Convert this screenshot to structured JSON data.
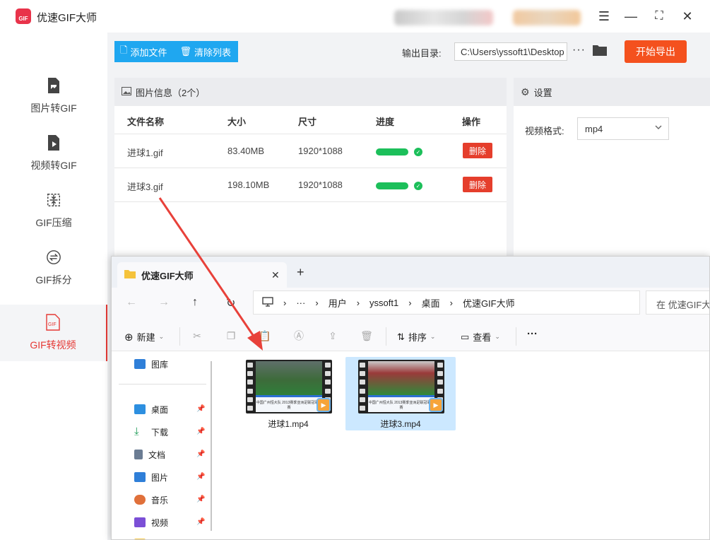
{
  "app": {
    "title": "优速GIF大师",
    "logo_text": "GIF"
  },
  "window_controls": {
    "menu": "☰",
    "minimize": "—",
    "maximize": "⛶",
    "close": "✕"
  },
  "sidebar": {
    "items": [
      {
        "label": "图片转GIF",
        "icon": "image-file-icon"
      },
      {
        "label": "视频转GIF",
        "icon": "video-file-icon"
      },
      {
        "label": "GIF压缩",
        "icon": "compress-icon"
      },
      {
        "label": "GIF拆分",
        "icon": "split-icon"
      },
      {
        "label": "GIF转视频",
        "icon": "gif-file-icon",
        "active": true
      }
    ]
  },
  "toolbar": {
    "add_file": "添加文件",
    "clear_list": "清除列表",
    "output_label": "输出目录:",
    "output_path": "C:\\Users\\yssoft1\\Desktop",
    "more": "···",
    "export": "开始导出"
  },
  "file_panel": {
    "title": "图片信息（2个）",
    "columns": [
      "文件名称",
      "大小",
      "尺寸",
      "进度",
      "操作"
    ],
    "rows": [
      {
        "name": "进球1.gif",
        "size": "83.40MB",
        "dims": "1920*1088",
        "progress": 1.0,
        "action": "删除"
      },
      {
        "name": "进球3.gif",
        "size": "198.10MB",
        "dims": "1920*1088",
        "progress": 1.0,
        "action": "删除"
      }
    ]
  },
  "settings": {
    "title": "设置",
    "format_label": "视频格式:",
    "format_value": "mp4"
  },
  "explorer": {
    "tab_title": "优速GIF大师",
    "new_tab": "+",
    "breadcrumb": [
      "用户",
      "yssoft1",
      "桌面",
      "优速GIF大师"
    ],
    "ellipsis": "···",
    "search_placeholder": "在 优速GIF大师",
    "commands": {
      "new": "新建",
      "sort": "排序",
      "view": "查看",
      "more": "···"
    },
    "sidebar": {
      "gallery": "图库",
      "items": [
        {
          "label": "桌面",
          "color": "#2d8fe0"
        },
        {
          "label": "下载",
          "color": "#1a9a55"
        },
        {
          "label": "文档",
          "color": "#6b7c93"
        },
        {
          "label": "图片",
          "color": "#2f7fd8"
        },
        {
          "label": "音乐",
          "color": "#e0703a"
        },
        {
          "label": "视频",
          "color": "#7b4fd6"
        }
      ]
    },
    "files": [
      {
        "name": "进球1.mp4",
        "selected": false,
        "banner": "中国广州恒大队 2013赛季亚洲足联冠军联赛"
      },
      {
        "name": "进球3.mp4",
        "selected": true,
        "banner": "中国广州恒大队 2013赛季亚洲足联冠军联赛"
      }
    ]
  },
  "colors": {
    "accent_blue": "#1fa7f0",
    "export_orange": "#f4511e",
    "active_red": "#e53935",
    "progress_green": "#1cbf5a",
    "arrow_red": "#e8413a"
  }
}
